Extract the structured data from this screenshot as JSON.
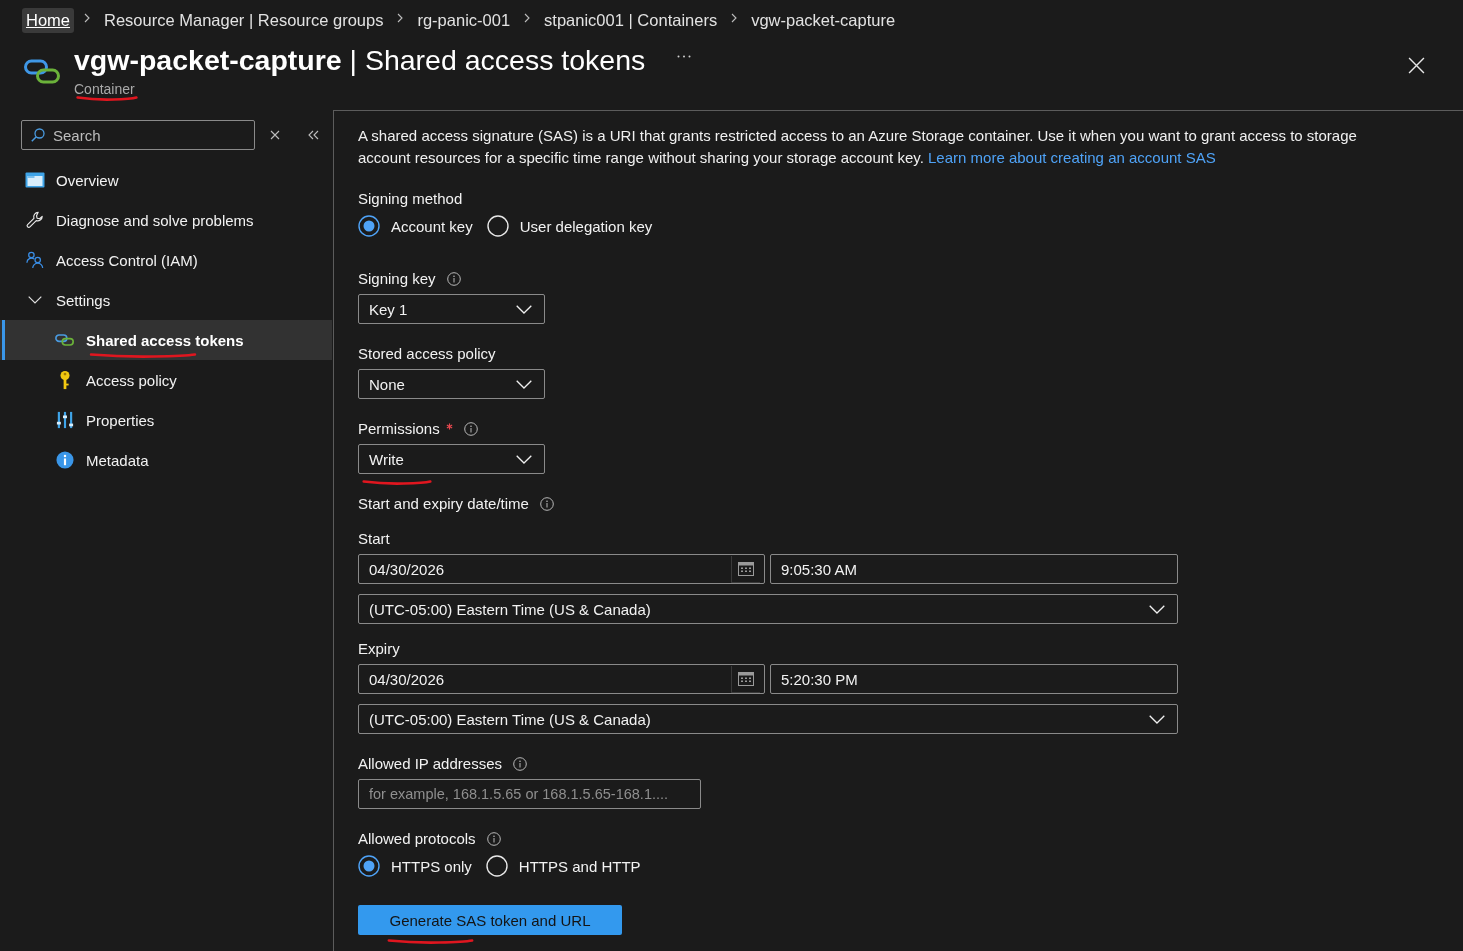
{
  "breadcrumb": [
    {
      "label": "Home",
      "focused": true
    },
    {
      "label": "Resource Manager | Resource groups",
      "focused": false
    },
    {
      "label": "rg-panic-001",
      "focused": false
    },
    {
      "label": "stpanic001 | Containers",
      "focused": false
    },
    {
      "label": "vgw-packet-capture",
      "focused": false
    }
  ],
  "header": {
    "title": "**vgw-packet-capture** | Shared access tokens",
    "subtitle": {
      "text": "Container",
      "annotated": true
    }
  },
  "sidebar": {
    "search": {
      "placeholder": "Search"
    },
    "items": [
      {
        "label": "Overview",
        "selected": false
      },
      {
        "label": "Diagnose and solve problems",
        "selected": false
      },
      {
        "label": "Access Control (IAM)",
        "selected": false
      },
      {
        "label": "Settings",
        "selected": false,
        "expanded": true,
        "children": [
          {
            "label": "Shared access tokens",
            "selected": true,
            "annotated": true
          },
          {
            "label": "Access policy",
            "selected": false
          },
          {
            "label": "Properties",
            "selected": false
          },
          {
            "label": "Metadata",
            "selected": false
          }
        ]
      }
    ]
  },
  "description": {
    "text": "A shared access signature (SAS) is a URI that grants restricted access to an Azure Storage container. Use it when you want to grant access to storage account resources for a specific time range without sharing your storage account key.",
    "link": "Learn more about creating an account SAS"
  },
  "form": [
    {
      "kind": "radio",
      "label": "Signing method",
      "options": [
        {
          "label": "Account key",
          "selected": true
        },
        {
          "label": "User delegation key",
          "selected": false
        }
      ]
    },
    {
      "kind": "select",
      "label": "Signing key",
      "info": true,
      "value": "Key 1"
    },
    {
      "kind": "select",
      "label": "Stored access policy",
      "value": "None"
    },
    {
      "kind": "select",
      "label": "Permissions",
      "info": true,
      "required": true,
      "value": "Write",
      "annotated": true
    },
    {
      "kind": "heading",
      "label": "Start and expiry date/time",
      "info": true
    },
    {
      "kind": "datetime",
      "label": "Start",
      "date": "04/30/2026",
      "time": "9:05:30 AM",
      "timezone": "(UTC-05:00) Eastern Time (US & Canada)"
    },
    {
      "kind": "datetime",
      "label": "Expiry",
      "date": "04/30/2026",
      "time": "5:20:30 PM",
      "timezone": "(UTC-05:00) Eastern Time (US & Canada)"
    },
    {
      "kind": "text",
      "label": "Allowed IP addresses",
      "info": true,
      "placeholder": "for example, 168.1.5.65 or 168.1.5.65-168.1...."
    },
    {
      "kind": "radio",
      "label": "Allowed protocols",
      "info": true,
      "options": [
        {
          "label": "HTTPS only",
          "selected": true
        },
        {
          "label": "HTTPS and HTTP",
          "selected": false
        }
      ]
    }
  ],
  "generate_button": {
    "label": "Generate SAS token and URL",
    "annotated": true
  }
}
